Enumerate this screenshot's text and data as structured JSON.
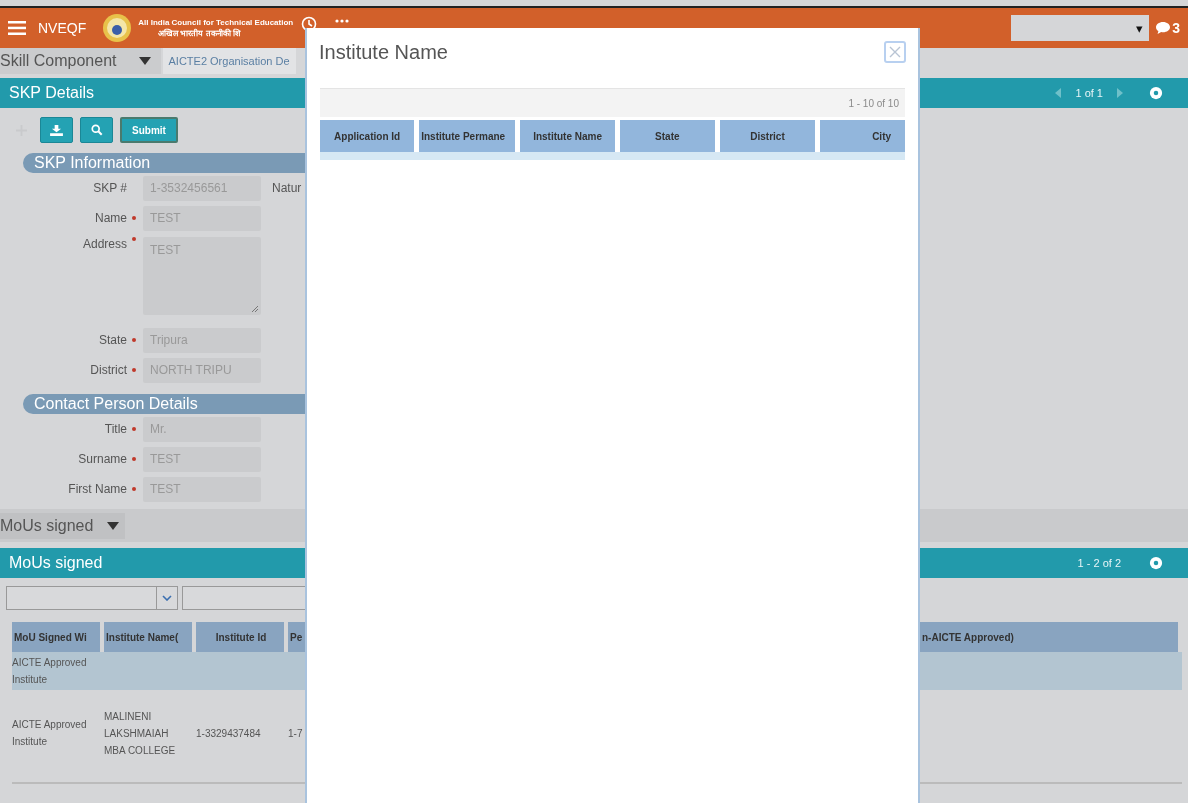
{
  "header": {
    "app_name": "NVEQF",
    "org_name_en": "All India Council for Technical Education",
    "org_name_hi": "अखिल भारतीय तकनीकी शि",
    "dropdown_caret": "▾",
    "notification_count": "3"
  },
  "selector": {
    "label": "Skill Component",
    "value": "AICTE2 Organisation De"
  },
  "skp_panel": {
    "title": "SKP Details",
    "pager": "1 of 1",
    "submit": "Submit"
  },
  "sections": [
    {
      "title": "SKP Information",
      "fields": [
        {
          "label": "SKP #",
          "required": false,
          "kind": "input",
          "value": "1-3532456561",
          "side_label": "Natur"
        },
        {
          "label": "Name",
          "required": true,
          "kind": "input",
          "value": "TEST"
        },
        {
          "label": "Address",
          "required": true,
          "kind": "textarea",
          "value": "TEST"
        },
        {
          "label": "State",
          "required": true,
          "kind": "input",
          "value": "Tripura"
        },
        {
          "label": "District",
          "required": true,
          "kind": "input",
          "value": "NORTH TRIPU"
        }
      ]
    },
    {
      "title": "Contact Person Details",
      "fields": [
        {
          "label": "Title",
          "required": true,
          "kind": "input",
          "value": "Mr."
        },
        {
          "label": "Surname",
          "required": true,
          "kind": "input",
          "value": "TEST"
        },
        {
          "label": "First Name",
          "required": true,
          "kind": "input",
          "value": "TEST"
        }
      ]
    }
  ],
  "mous_toggle": {
    "label": "MoUs signed"
  },
  "mous_panel": {
    "title": "MoUs signed",
    "pager": "1 - 2 of 2",
    "columns": [
      "MoU Signed Wi",
      "Institute Name(",
      "Institute Id",
      "Pe",
      "n-AICTE Approved)"
    ],
    "rows": [
      {
        "selected": true,
        "cells": [
          "AICTE Approved Institute"
        ]
      },
      {
        "selected": false,
        "cells": [
          "AICTE Approved Institute",
          "MALINENI LAKSHMAIAH MBA COLLEGE",
          "1-3329437484",
          "1-7"
        ]
      }
    ]
  },
  "dialog": {
    "title": "Institute Name",
    "pager": "1 - 10 of 10",
    "columns": [
      "Application Id",
      "Institute Permane",
      "Institute Name",
      "State",
      "District",
      "City"
    ]
  }
}
